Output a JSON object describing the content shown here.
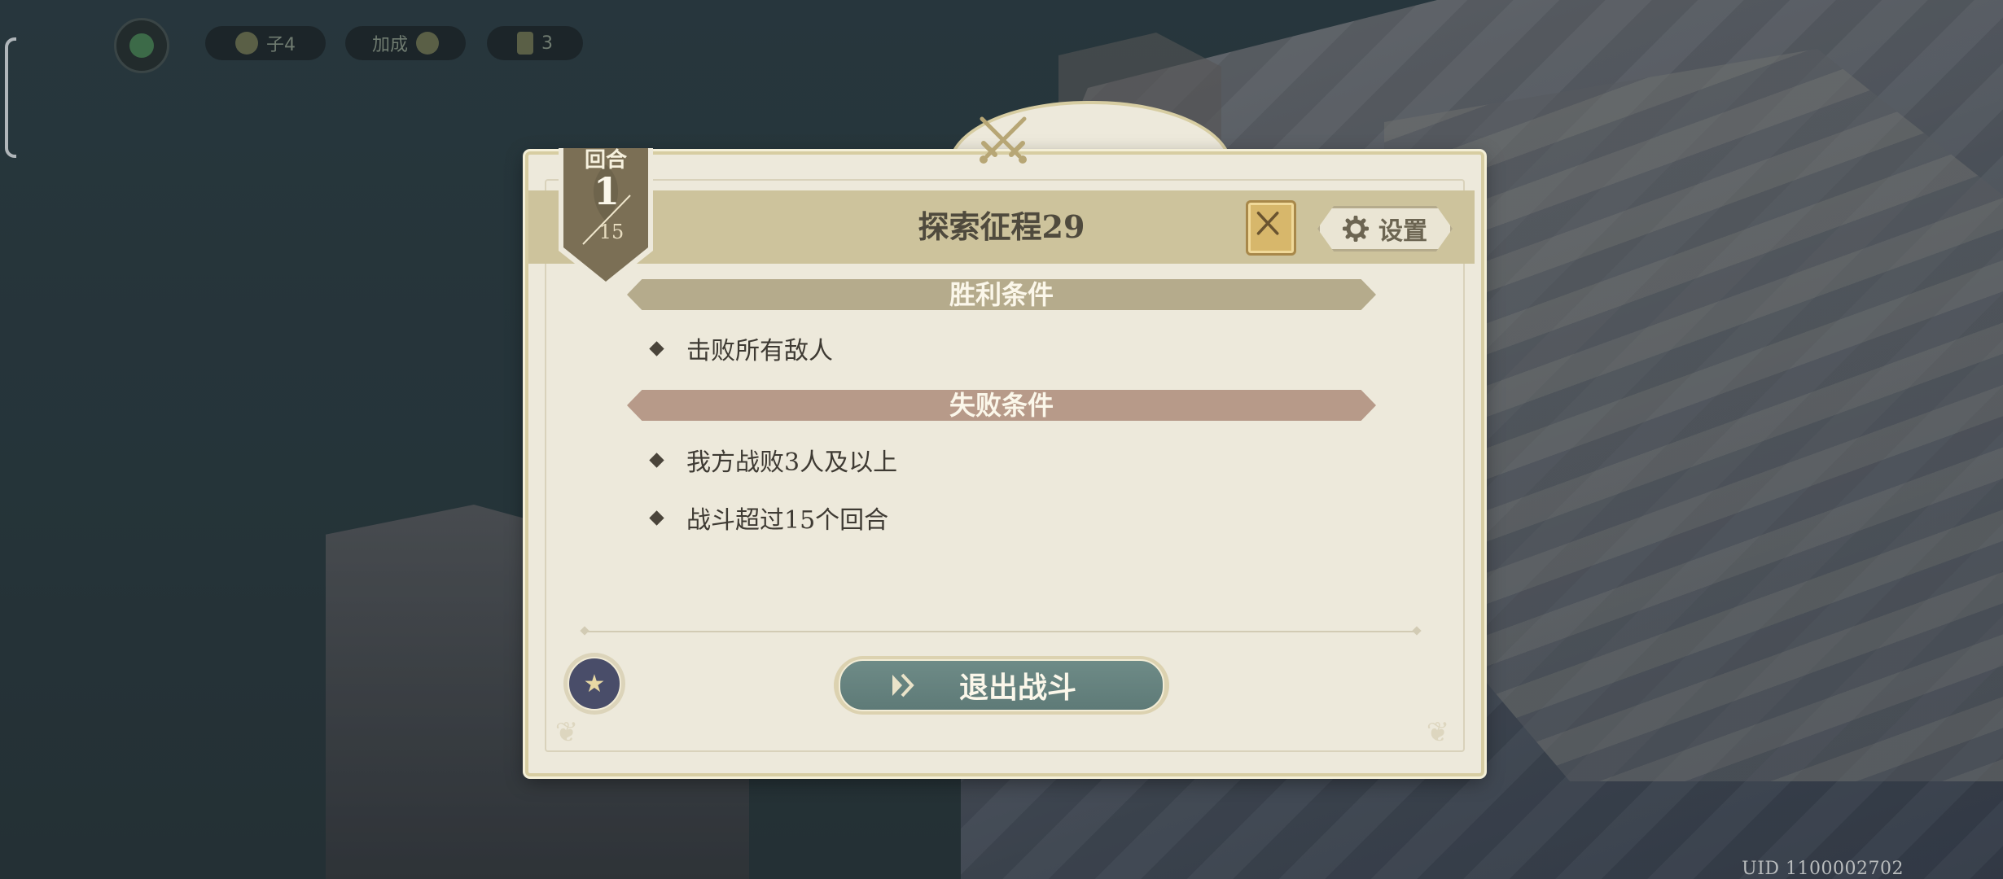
{
  "hud": {
    "pill_a_label": "子4",
    "pill_b_label": "加成",
    "pill_c_value": "3"
  },
  "dialog": {
    "title": "探索征程29",
    "round_label": "回合",
    "round_current": "1",
    "round_max": "15",
    "settings_label": "设置",
    "victory_header": "胜利条件",
    "victory_conditions": [
      "击败所有敌人"
    ],
    "defeat_header": "失败条件",
    "defeat_conditions": [
      "我方战败3人及以上",
      "战斗超过15个回合"
    ],
    "exit_button_label": "退出战斗"
  },
  "uid_text": "UID 1100002702",
  "colors": {
    "panel_bg": "#ede9db",
    "header_band": "#cdc39c",
    "victory_bar": "#b5ab8c",
    "defeat_bar": "#b79a89",
    "exit_button": "#6e8b87",
    "round_badge": "#7b6f55"
  },
  "icons": {
    "crest": "crossed-swords-icon",
    "book": "battle-book-icon",
    "settings": "gear-icon",
    "exit": "double-chevron-right-icon",
    "skill": "star-summon-icon"
  }
}
